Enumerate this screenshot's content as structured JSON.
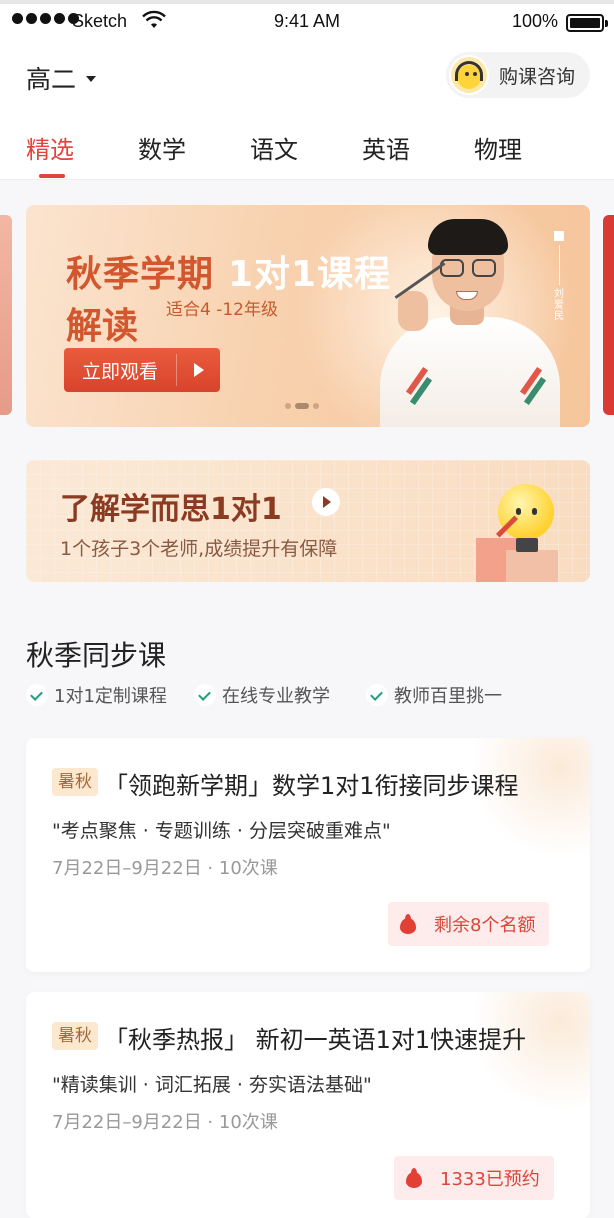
{
  "status_bar": {
    "carrier": "Sketch",
    "time": "9:41 AM",
    "battery": "100%"
  },
  "header": {
    "grade": "高二",
    "consult_label": "购课咨询"
  },
  "tabs": [
    {
      "label": "精选",
      "active": true
    },
    {
      "label": "数学",
      "active": false
    },
    {
      "label": "语文",
      "active": false
    },
    {
      "label": "英语",
      "active": false
    },
    {
      "label": "物理",
      "active": false
    }
  ],
  "banner": {
    "title_part1": "秋季学期",
    "title_part2": "1对1课程",
    "title_line2": "解读",
    "subtitle": "适合4 -12年级",
    "button_label": "立即观看",
    "teacher_name": "刘爱民",
    "slide_count": 3,
    "active_slide": 2
  },
  "info_card": {
    "title": "了解学而思1对1",
    "subtitle": "1个孩子3个老师,成绩提升有保障"
  },
  "section": {
    "title": "秋季同步课",
    "features": [
      "1对1定制课程",
      "在线专业教学",
      "教师百里挑一"
    ]
  },
  "courses": [
    {
      "tag": "暑秋",
      "title": "「领跑新学期」数学1对1衔接同步课程",
      "desc": "\"考点聚焦 · 专题训练 · 分层突破重难点\"",
      "meta": "7月22日–9月22日 · 10次课",
      "status": "剩余8个名额"
    },
    {
      "tag": "暑秋",
      "title": "「秋季热报」 新初一英语1对1快速提升",
      "desc": "\"精读集训 · 词汇拓展 · 夯实语法基础\"",
      "meta": "7月22日–9月22日 · 10次课",
      "status": "1333已预约"
    }
  ],
  "colors": {
    "accent": "#e4433c",
    "banner_title": "#d3572e",
    "check": "#1fa07e",
    "tag_bg": "#fbe8cf",
    "status_text": "#d9463b"
  }
}
